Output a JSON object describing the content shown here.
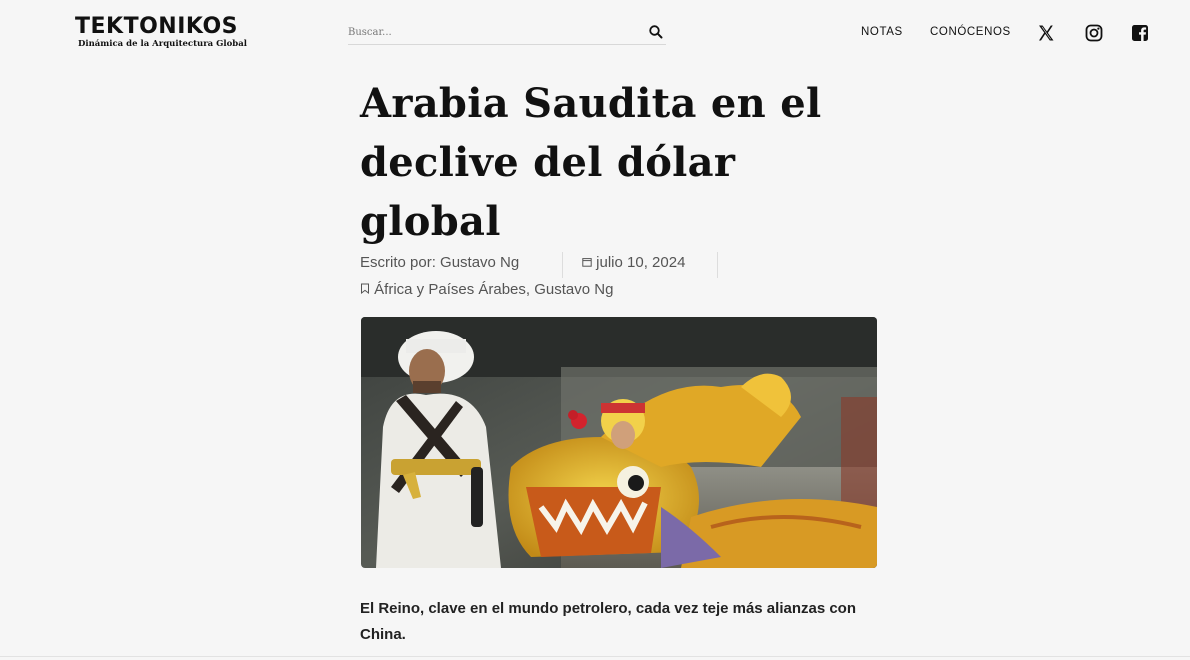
{
  "header": {
    "logo": {
      "name": "TEKTONIKOS",
      "tagline": "Dinámica de la Arquitectura Global"
    },
    "search": {
      "placeholder": "Buscar..."
    },
    "nav": [
      {
        "label": "NOTAS"
      },
      {
        "label": "CONÓCENOS"
      }
    ],
    "social": [
      {
        "icon": "x-twitter-icon"
      },
      {
        "icon": "instagram-icon"
      },
      {
        "icon": "facebook-icon"
      }
    ]
  },
  "article": {
    "title_lines": [
      "Arabia Saudita en el",
      "declive del dólar",
      "global"
    ],
    "author": "Escrito por: Gustavo Ng",
    "date": "julio 10, 2024",
    "tags": "África y Países Árabes, Gustavo Ng",
    "image": {
      "description_icon": "dragon-dance-photo"
    },
    "lead": "El Reino, clave en el mundo petrolero, cada vez teje más alianzas con China."
  },
  "colors": {
    "background": "#f6f6f6",
    "text": "#111111",
    "meta": "#555555"
  }
}
